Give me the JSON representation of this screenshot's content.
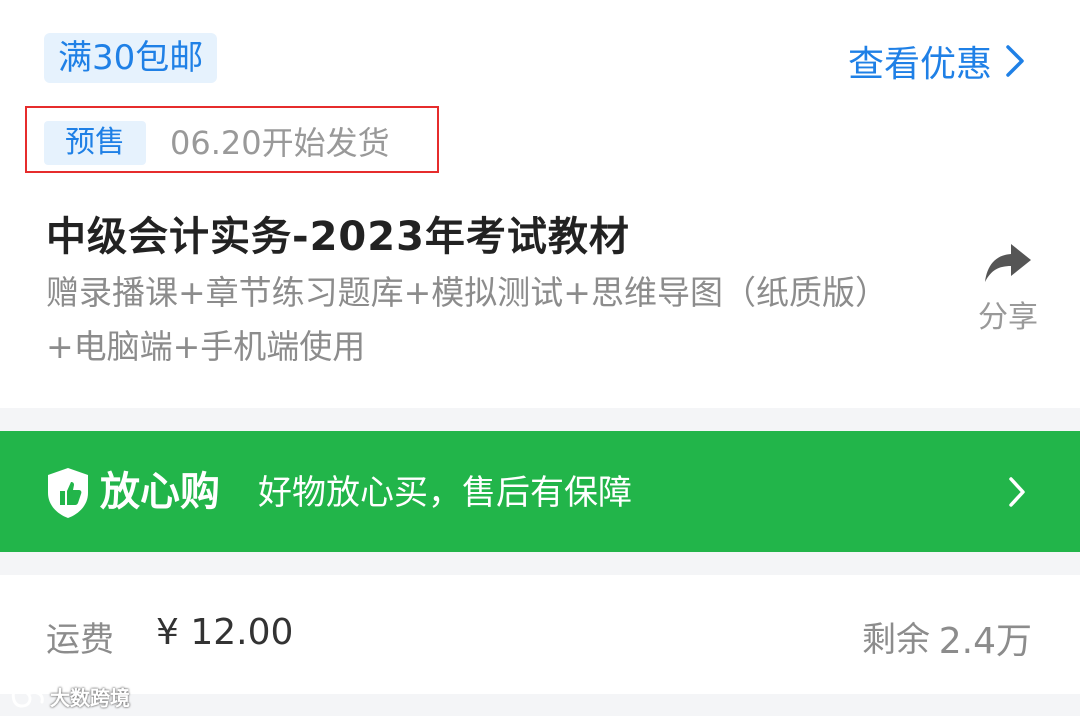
{
  "promo": {
    "shipping_badge": "满30包邮",
    "offers_link": "查看优惠"
  },
  "presale": {
    "badge": "预售",
    "ship_date_text": "06.20开始发货"
  },
  "product": {
    "title": "中级会计实务-2023年考试教材",
    "subtitle": "赠录播课+章节练习题库+模拟测试+思维导图（纸质版）+电脑端+手机端使用"
  },
  "share": {
    "label": "分享",
    "icon": "share-arrow-icon"
  },
  "assurance": {
    "title": "放心购",
    "description": "好物放心买，售后有保障",
    "icon": "shield-thumbs-up-icon"
  },
  "shipping": {
    "fee_label": "运费",
    "fee_value": "¥ 12.00",
    "stock_label": "剩余",
    "stock_value": "2.4万"
  },
  "watermark": {
    "text": "大数跨境"
  },
  "colors": {
    "accent_blue": "#1f80e6",
    "badge_bg": "#e6f2fd",
    "highlight_red": "#e62c2c",
    "banner_green": "#22b54a",
    "muted_text": "#8c8c8c"
  }
}
